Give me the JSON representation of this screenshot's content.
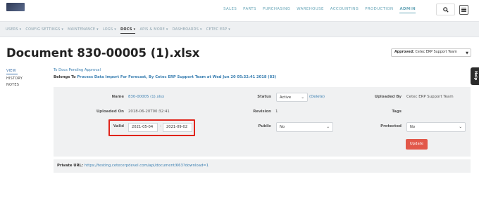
{
  "topnav": {
    "items": [
      "SALES",
      "PARTS",
      "PURCHASING",
      "WAREHOUSE",
      "ACCOUNTING",
      "PRODUCTION",
      "ADMIN"
    ],
    "active": "ADMIN"
  },
  "subnav": {
    "items": [
      "USERS ▾",
      "CONFIG SETTINGS ▾",
      "MAINTENANCE ▾",
      "LOGS ▾",
      "DOCS ▾",
      "APIS & MORE ▾",
      "DASHBOARDS ▾",
      "CETEC ERP ▾"
    ],
    "active": "DOCS ▾"
  },
  "page": {
    "title": "Document 830-00005 (1).xlsx",
    "approved_label": "Approved:",
    "approved_value": "Cetec ERP Support Team"
  },
  "leftnav": {
    "items": [
      "VIEW",
      "HISTORY",
      "NOTES"
    ],
    "active": "VIEW"
  },
  "header_links": {
    "pending": "To Docs Pending Approval",
    "belongs_prefix": "Belongs To",
    "belongs_link": "Process Data Import For Forecast, By Cetec ERP Support Team at Wed Jun 20 05:32:41 2018 (83)"
  },
  "details": {
    "name_label": "Name",
    "name_value": "830-00005 (1).xlsx",
    "status_label": "Status",
    "status_value": "Active",
    "delete_link": "(Delete)",
    "uploaded_by_label": "Uploaded By",
    "uploaded_by_value": "Cetec ERP Support Team",
    "uploaded_on_label": "Uploaded On",
    "uploaded_on_value": "2018-06-20T00:32:41",
    "revision_label": "Revision",
    "revision_value": "1",
    "tags_label": "Tags",
    "valid_label": "Valid",
    "valid_from": "2021-05-04",
    "valid_sep": "-",
    "valid_to": "2021-09-02",
    "public_label": "Public",
    "public_value": "No",
    "protected_label": "Protected",
    "protected_value": "No",
    "update_label": "Update"
  },
  "private": {
    "label": "Private URL:",
    "url": "https://testing.cetecerpdevel.com/api/document/663?download=1"
  },
  "help": {
    "label": "Help"
  },
  "colors": {
    "accent": "#3a7fb1",
    "update_button": "#e2584a",
    "highlight": "#e0241b"
  }
}
